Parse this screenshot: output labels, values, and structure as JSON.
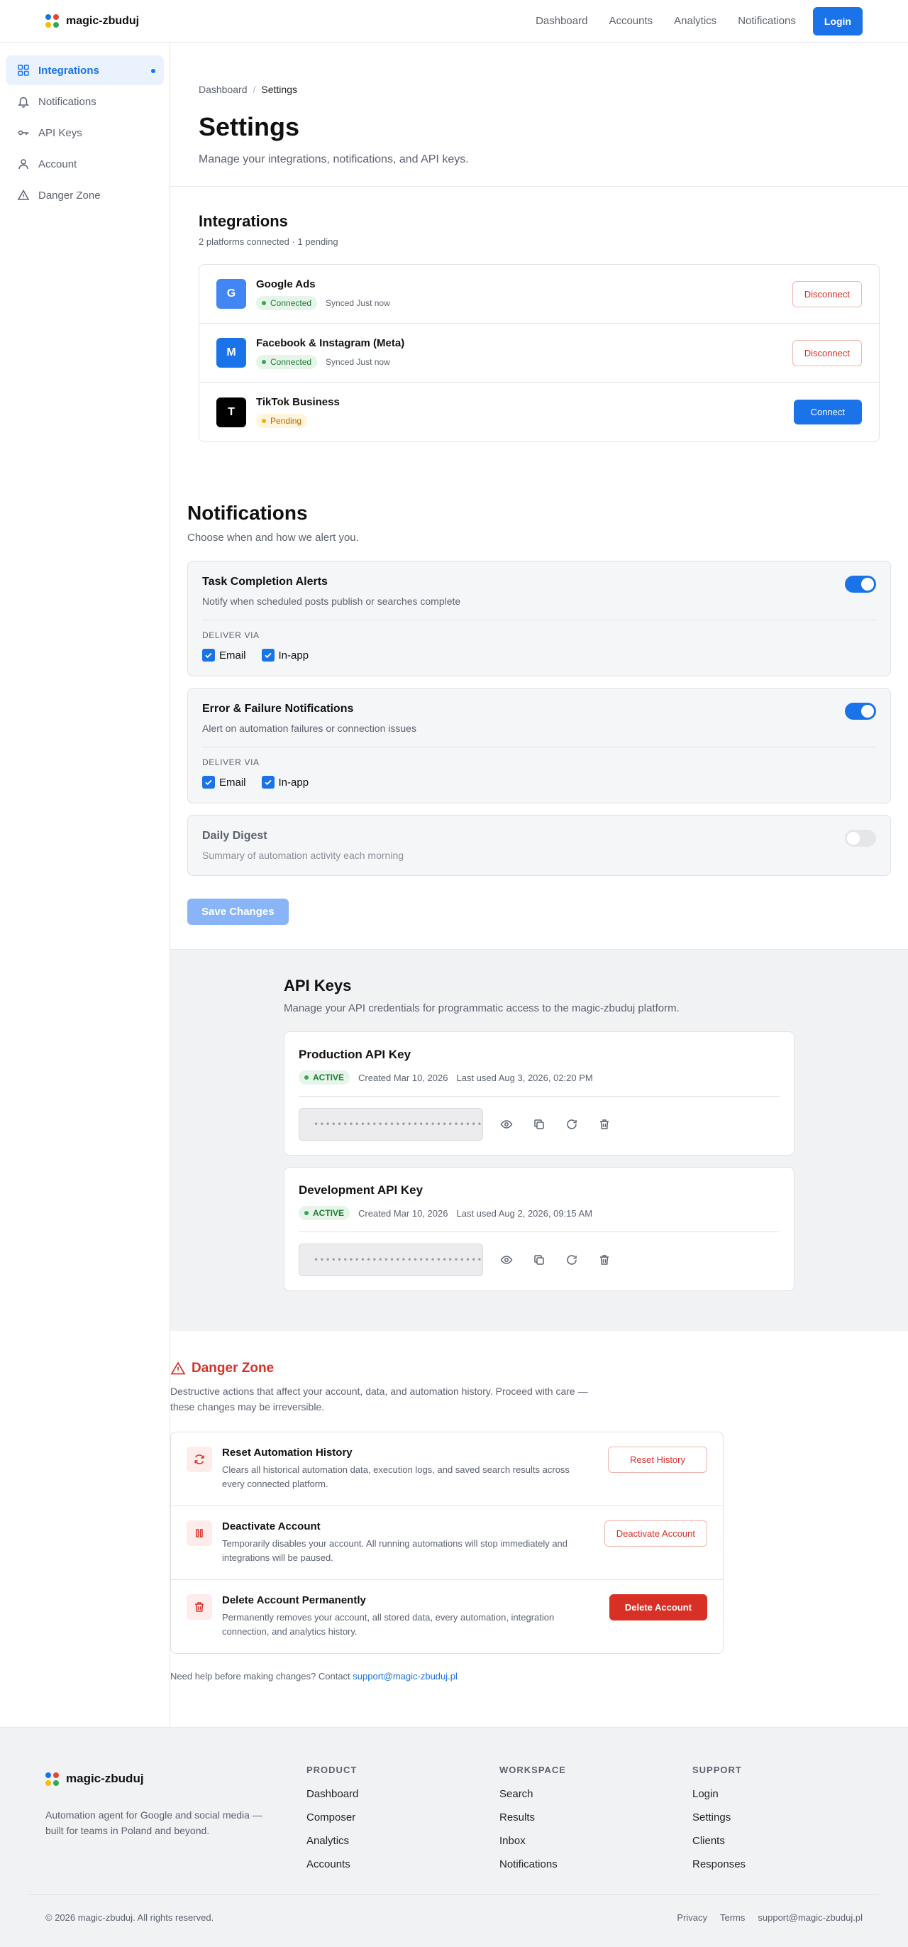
{
  "brand": {
    "name": "magic-zbuduj",
    "dot_colors": [
      "#1a73e8",
      "#ea4335",
      "#fbbc04",
      "#34a853"
    ]
  },
  "header": {
    "nav": [
      "Dashboard",
      "Accounts",
      "Analytics",
      "Notifications"
    ],
    "login_label": "Login"
  },
  "sidebar": {
    "items": [
      {
        "label": "Integrations",
        "icon": "grid-icon",
        "active": true
      },
      {
        "label": "Notifications",
        "icon": "bell-icon"
      },
      {
        "label": "API Keys",
        "icon": "key-icon"
      },
      {
        "label": "Account",
        "icon": "user-icon"
      },
      {
        "label": "Danger Zone",
        "icon": "warning-triangle-icon"
      }
    ]
  },
  "breadcrumb": {
    "parent": "Dashboard",
    "separator": "/",
    "current": "Settings"
  },
  "page": {
    "title": "Settings",
    "subtitle": "Manage your integrations, notifications, and API keys."
  },
  "integrations": {
    "title": "Integrations",
    "summary": "2 platforms connected · 1 pending",
    "items": [
      {
        "logo_letter": "G",
        "logo_color": "#4285f4",
        "name": "Google Ads",
        "status": "Connected",
        "synced": "Synced Just now",
        "action": "Disconnect"
      },
      {
        "logo_letter": "M",
        "logo_color": "#1a73e8",
        "name": "Facebook & Instagram (Meta)",
        "status": "Connected",
        "synced": "Synced Just now",
        "action": "Disconnect"
      },
      {
        "logo_letter": "T",
        "logo_color": "#000000",
        "name": "TikTok Business",
        "status": "Pending",
        "synced": "",
        "action": "Connect"
      }
    ]
  },
  "notifications": {
    "title": "Notifications",
    "subtitle": "Choose when and how we alert you.",
    "deliver_label": "DELIVER VIA",
    "cards": [
      {
        "title": "Task Completion Alerts",
        "desc": "Notify when scheduled posts publish or searches complete",
        "enabled": true,
        "email_label": "Email",
        "inapp_label": "In-app"
      },
      {
        "title": "Error & Failure Notifications",
        "desc": "Alert on automation failures or connection issues",
        "enabled": true,
        "email_label": "Email",
        "inapp_label": "In-app"
      },
      {
        "title": "Daily Digest",
        "desc": "Summary of automation activity each morning",
        "enabled": false
      }
    ],
    "save_label": "Save Changes"
  },
  "api_keys": {
    "title": "API Keys",
    "subtitle": "Manage your API credentials for programmatic access to the magic-zbuduj platform.",
    "keys": [
      {
        "name": "Production API Key",
        "status": "ACTIVE",
        "created": "Created Mar 10, 2026",
        "last_used": "Last used Aug 3, 2026, 02:20 PM",
        "masked": "••••••••••••••••••••••••••••••••"
      },
      {
        "name": "Development API Key",
        "status": "ACTIVE",
        "created": "Created Mar 10, 2026",
        "last_used": "Last used Aug 2, 2026, 09:15 AM",
        "masked": "••••••••••••••••••••••••••••••••"
      }
    ]
  },
  "danger_zone": {
    "title": "Danger Zone",
    "desc": "Destructive actions that affect your account, data, and automation history. Proceed with care — these changes may be irreversible.",
    "items": [
      {
        "title": "Reset Automation History",
        "desc": "Clears all historical automation data, execution logs, and saved search results across every connected platform.",
        "action": "Reset History",
        "icon": "refresh-icon"
      },
      {
        "title": "Deactivate Account",
        "desc": "Temporarily disables your account. All running automations will stop immediately and integrations will be paused.",
        "action": "Deactivate Account",
        "icon": "pause-icon"
      },
      {
        "title": "Delete Account Permanently",
        "desc": "Permanently removes your account, all stored data, every automation, integration connection, and analytics history.",
        "action": "Delete Account",
        "icon": "trash-icon"
      }
    ],
    "help_text": "Need help before making changes? Contact ",
    "help_email": "support@magic-zbuduj.pl"
  },
  "footer": {
    "tagline": "Automation agent for Google and social media — built for teams in Poland and beyond.",
    "columns": [
      {
        "title": "PRODUCT",
        "links": [
          "Dashboard",
          "Composer",
          "Analytics",
          "Accounts"
        ]
      },
      {
        "title": "WORKSPACE",
        "links": [
          "Search",
          "Results",
          "Inbox",
          "Notifications"
        ]
      },
      {
        "title": "SUPPORT",
        "links": [
          "Login",
          "Settings",
          "Clients",
          "Responses"
        ]
      }
    ],
    "copyright": "© 2026 magic-zbuduj. All rights reserved.",
    "bottom_links": [
      "Privacy",
      "Terms",
      "support@magic-zbuduj.pl"
    ]
  }
}
